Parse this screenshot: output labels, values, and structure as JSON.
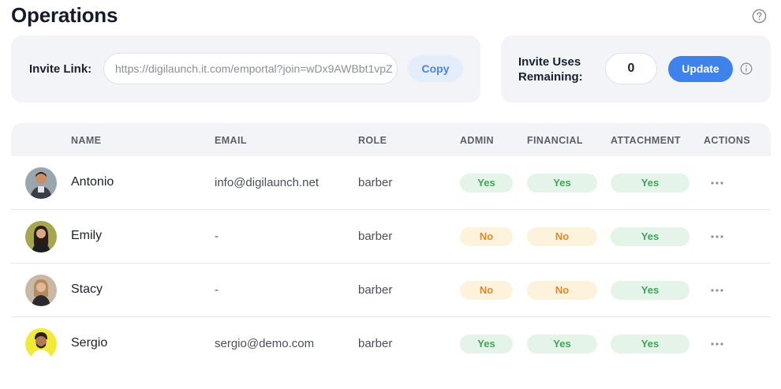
{
  "page": {
    "title": "Operations"
  },
  "invite": {
    "label": "Invite Link:",
    "link": "https://digilaunch.it.com/emportal?join=wDx9AWBbt1vpZ",
    "copy_label": "Copy"
  },
  "uses": {
    "label": "Invite Uses Remaining:",
    "value": "0",
    "update_label": "Update"
  },
  "table": {
    "headers": {
      "name": "NAME",
      "email": "EMAIL",
      "role": "ROLE",
      "admin": "ADMIN",
      "financial": "FINANCIAL",
      "attachment": "ATTACHMENT",
      "actions": "ACTIONS"
    },
    "rows": [
      {
        "name": "Antonio",
        "email": "info@digilaunch.net",
        "role": "barber",
        "admin": "Yes",
        "financial": "Yes",
        "attachment": "Yes"
      },
      {
        "name": "Emily",
        "email": "-",
        "role": "barber",
        "admin": "No",
        "financial": "No",
        "attachment": "Yes"
      },
      {
        "name": "Stacy",
        "email": "-",
        "role": "barber",
        "admin": "No",
        "financial": "No",
        "attachment": "Yes"
      },
      {
        "name": "Sergio",
        "email": "sergio@demo.com",
        "role": "barber",
        "admin": "Yes",
        "financial": "Yes",
        "attachment": "Yes"
      }
    ]
  },
  "colors": {
    "accent": "#3f82ec",
    "yes_bg": "#e4f4e8",
    "yes_text": "#3ba65a",
    "no_bg": "#fdf3dc",
    "no_text": "#e3891b"
  },
  "icons": {
    "help": "help-circle-icon",
    "info": "info-icon",
    "actions": "more-horizontal-icon"
  }
}
